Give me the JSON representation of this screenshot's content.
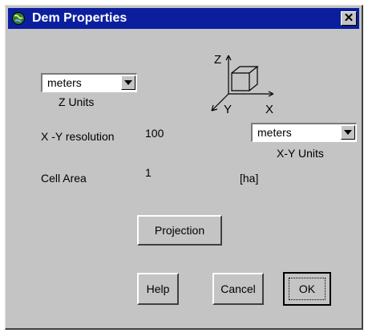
{
  "window": {
    "title": "Dem Properties",
    "close_glyph": "✕",
    "icon": "globe-app-icon"
  },
  "z_units": {
    "selected": "meters",
    "caption": "Z  Units"
  },
  "axes_diagram": {
    "z_label": "Z",
    "y_label": "Y",
    "x_label": "X"
  },
  "xy_resolution": {
    "label": "X -Y resolution",
    "value": "100"
  },
  "xy_units": {
    "selected": "meters",
    "caption": "X-Y Units"
  },
  "cell_area": {
    "label": "Cell Area",
    "value": "1",
    "unit": "[ha]"
  },
  "buttons": {
    "projection": "Projection",
    "help": "Help",
    "cancel": "Cancel",
    "ok": "OK"
  },
  "colors": {
    "titlebar": "#0b1f9e",
    "dialog_bg": "#c4c4c4"
  }
}
